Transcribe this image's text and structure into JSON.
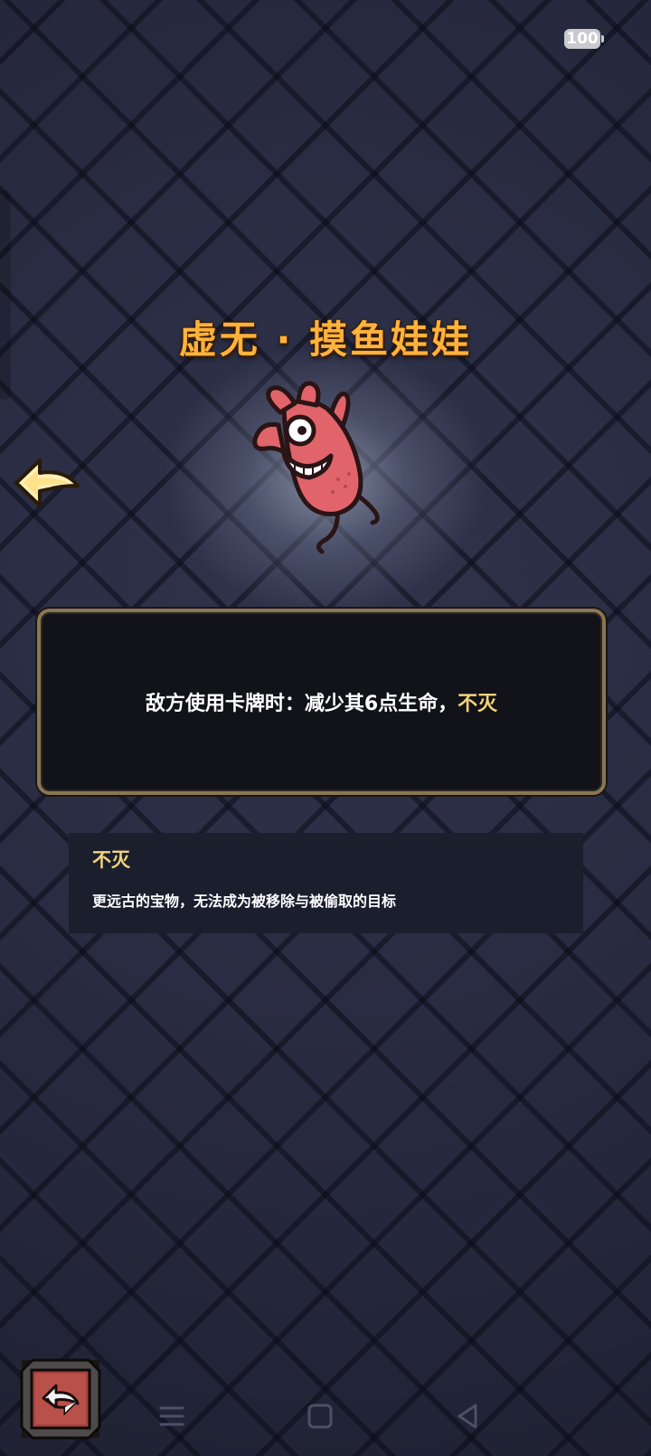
{
  "status_bar": {
    "battery": "100"
  },
  "relic": {
    "title": "虚无 · 摸鱼娃娃",
    "effect_prefix": "敌方使用卡牌时：减少其6点生命，",
    "effect_keyword": "不灭"
  },
  "keyword": {
    "title": "不灭",
    "description": "更远古的宝物，无法成为被移除与被偷取的目标"
  },
  "icons": {
    "back": "left-arrow-icon",
    "return": "return-arrow-icon",
    "relic": "pink-doll-relic-icon",
    "nav_menu": "menu-icon",
    "nav_home": "home-icon",
    "nav_back": "back-triangle-icon"
  },
  "colors": {
    "title": "#ffb23c",
    "keyword": "#f2d37a",
    "frame": "#8a7654",
    "doll": "#e0646a"
  }
}
